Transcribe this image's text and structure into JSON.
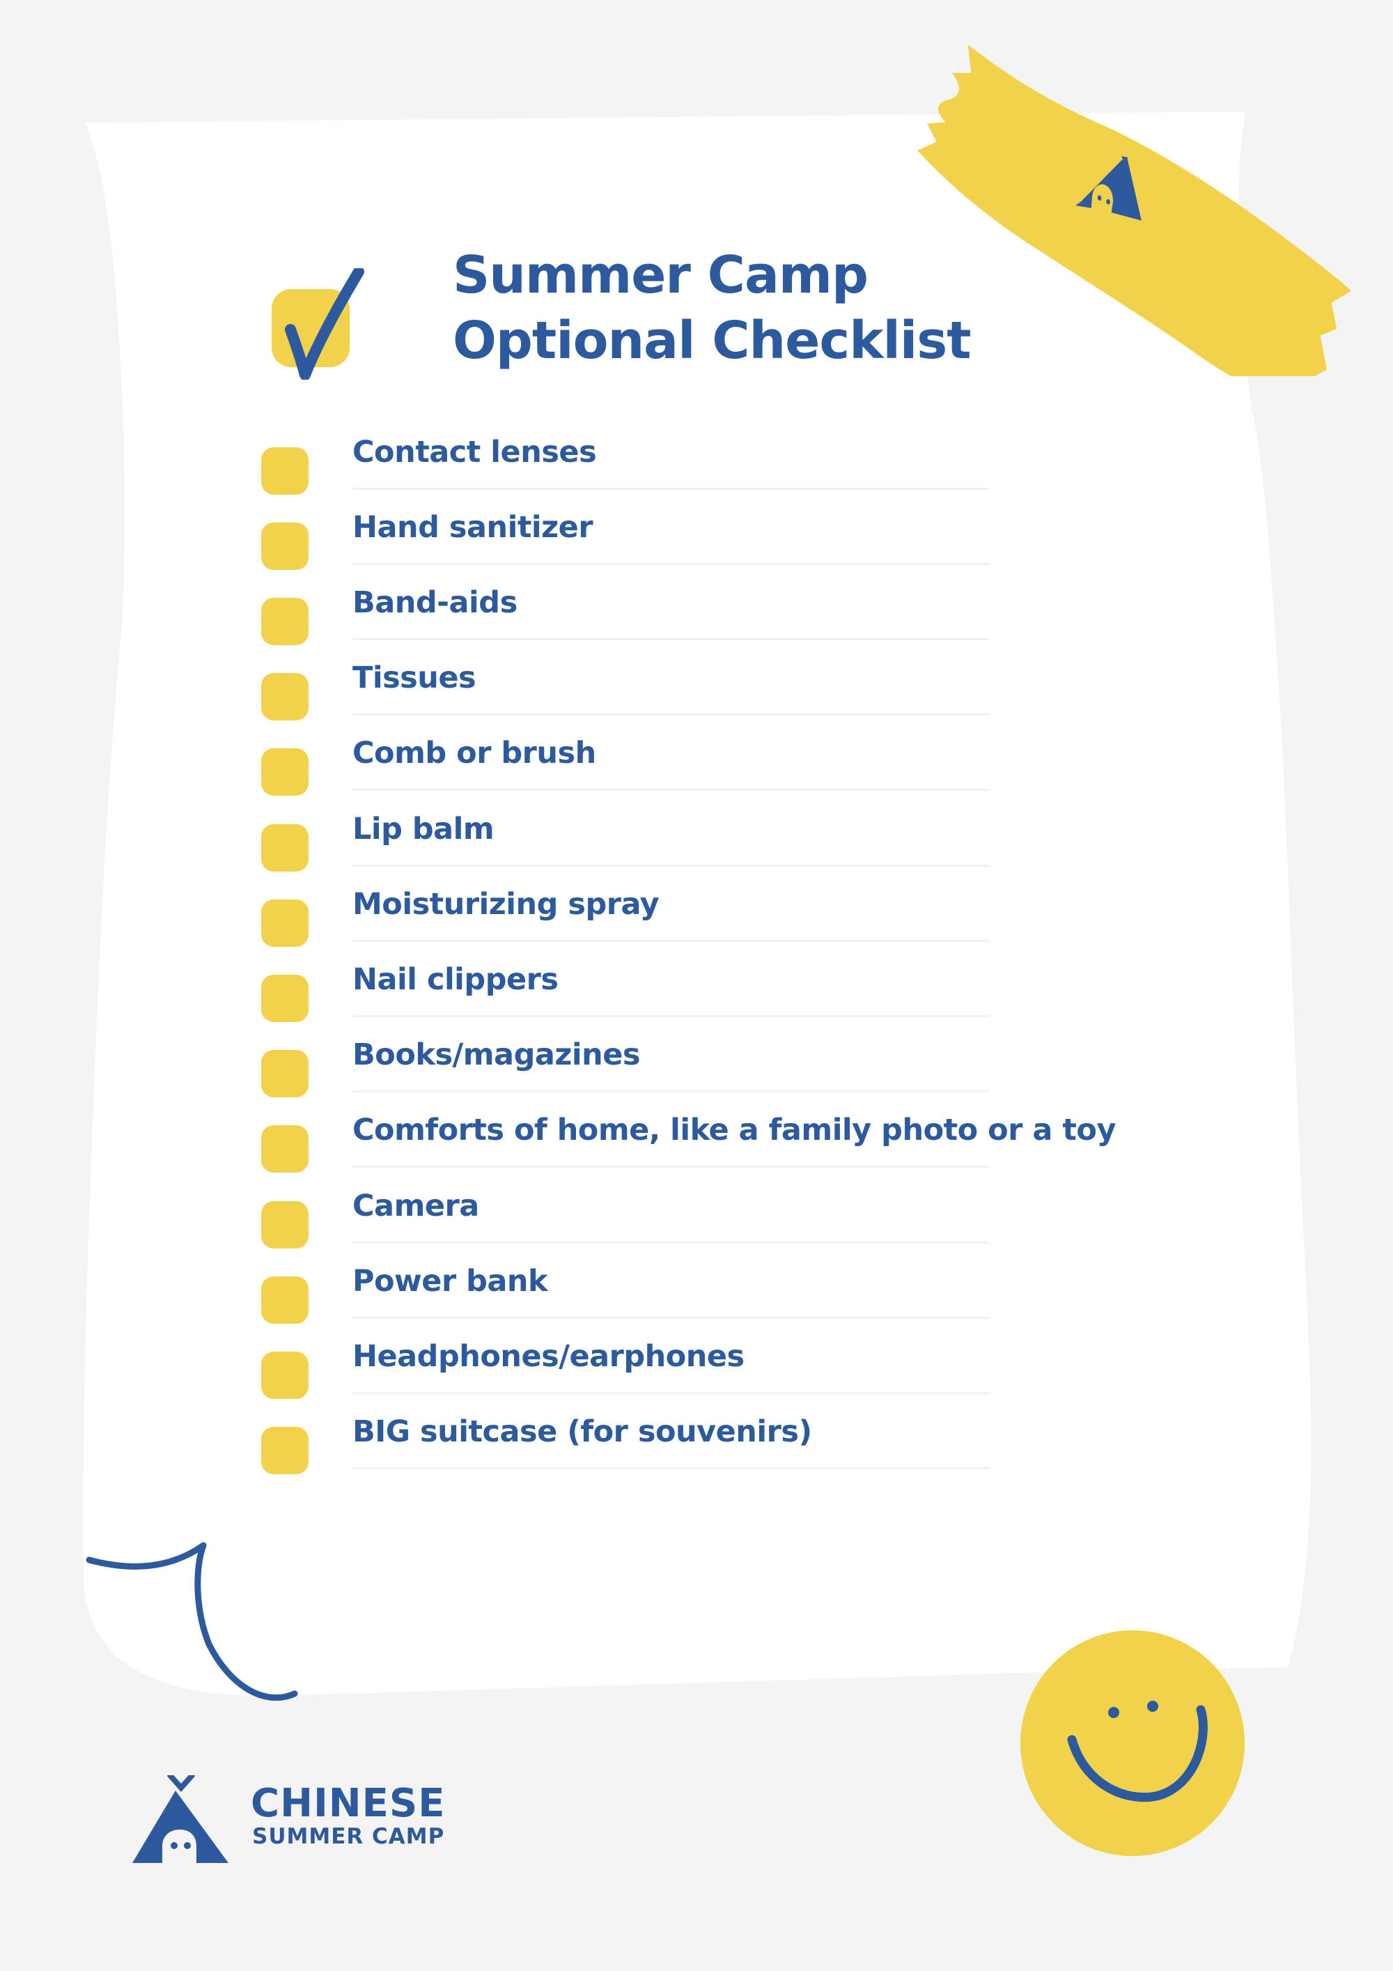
{
  "colors": {
    "background": "#f4f4f4",
    "paper": "#ffffff",
    "accent_blue": "#2d5a9e",
    "accent_yellow": "#f1d24a",
    "divider": "#f2f2f2"
  },
  "header": {
    "title_line1": "Summer Camp",
    "title_line2": "Optional Checklist",
    "icon": "checkmark-icon"
  },
  "checklist": {
    "items": [
      {
        "label": "Contact lenses",
        "checked": false
      },
      {
        "label": "Hand sanitizer",
        "checked": false
      },
      {
        "label": "Band-aids",
        "checked": false
      },
      {
        "label": "Tissues",
        "checked": false
      },
      {
        "label": "Comb or brush",
        "checked": false
      },
      {
        "label": "Lip balm",
        "checked": false
      },
      {
        "label": "Moisturizing spray",
        "checked": false
      },
      {
        "label": "Nail clippers",
        "checked": false
      },
      {
        "label": "Books/magazines",
        "checked": false
      },
      {
        "label": "Comforts of home, like a family photo or a toy",
        "checked": false
      },
      {
        "label": "Camera",
        "checked": false
      },
      {
        "label": "Power bank",
        "checked": false
      },
      {
        "label": "Headphones/earphones",
        "checked": false
      },
      {
        "label": "BIG suitcase (for souvenirs)",
        "checked": false
      }
    ]
  },
  "decorations": {
    "tape_icon": "tent-icon",
    "corner_icon": "page-curl-icon",
    "sticker_icon": "smiley-face-icon"
  },
  "footer": {
    "logo_icon": "tent-logo-icon",
    "brand_line1": "CHINESE",
    "brand_line2": "SUMMER CAMP"
  }
}
